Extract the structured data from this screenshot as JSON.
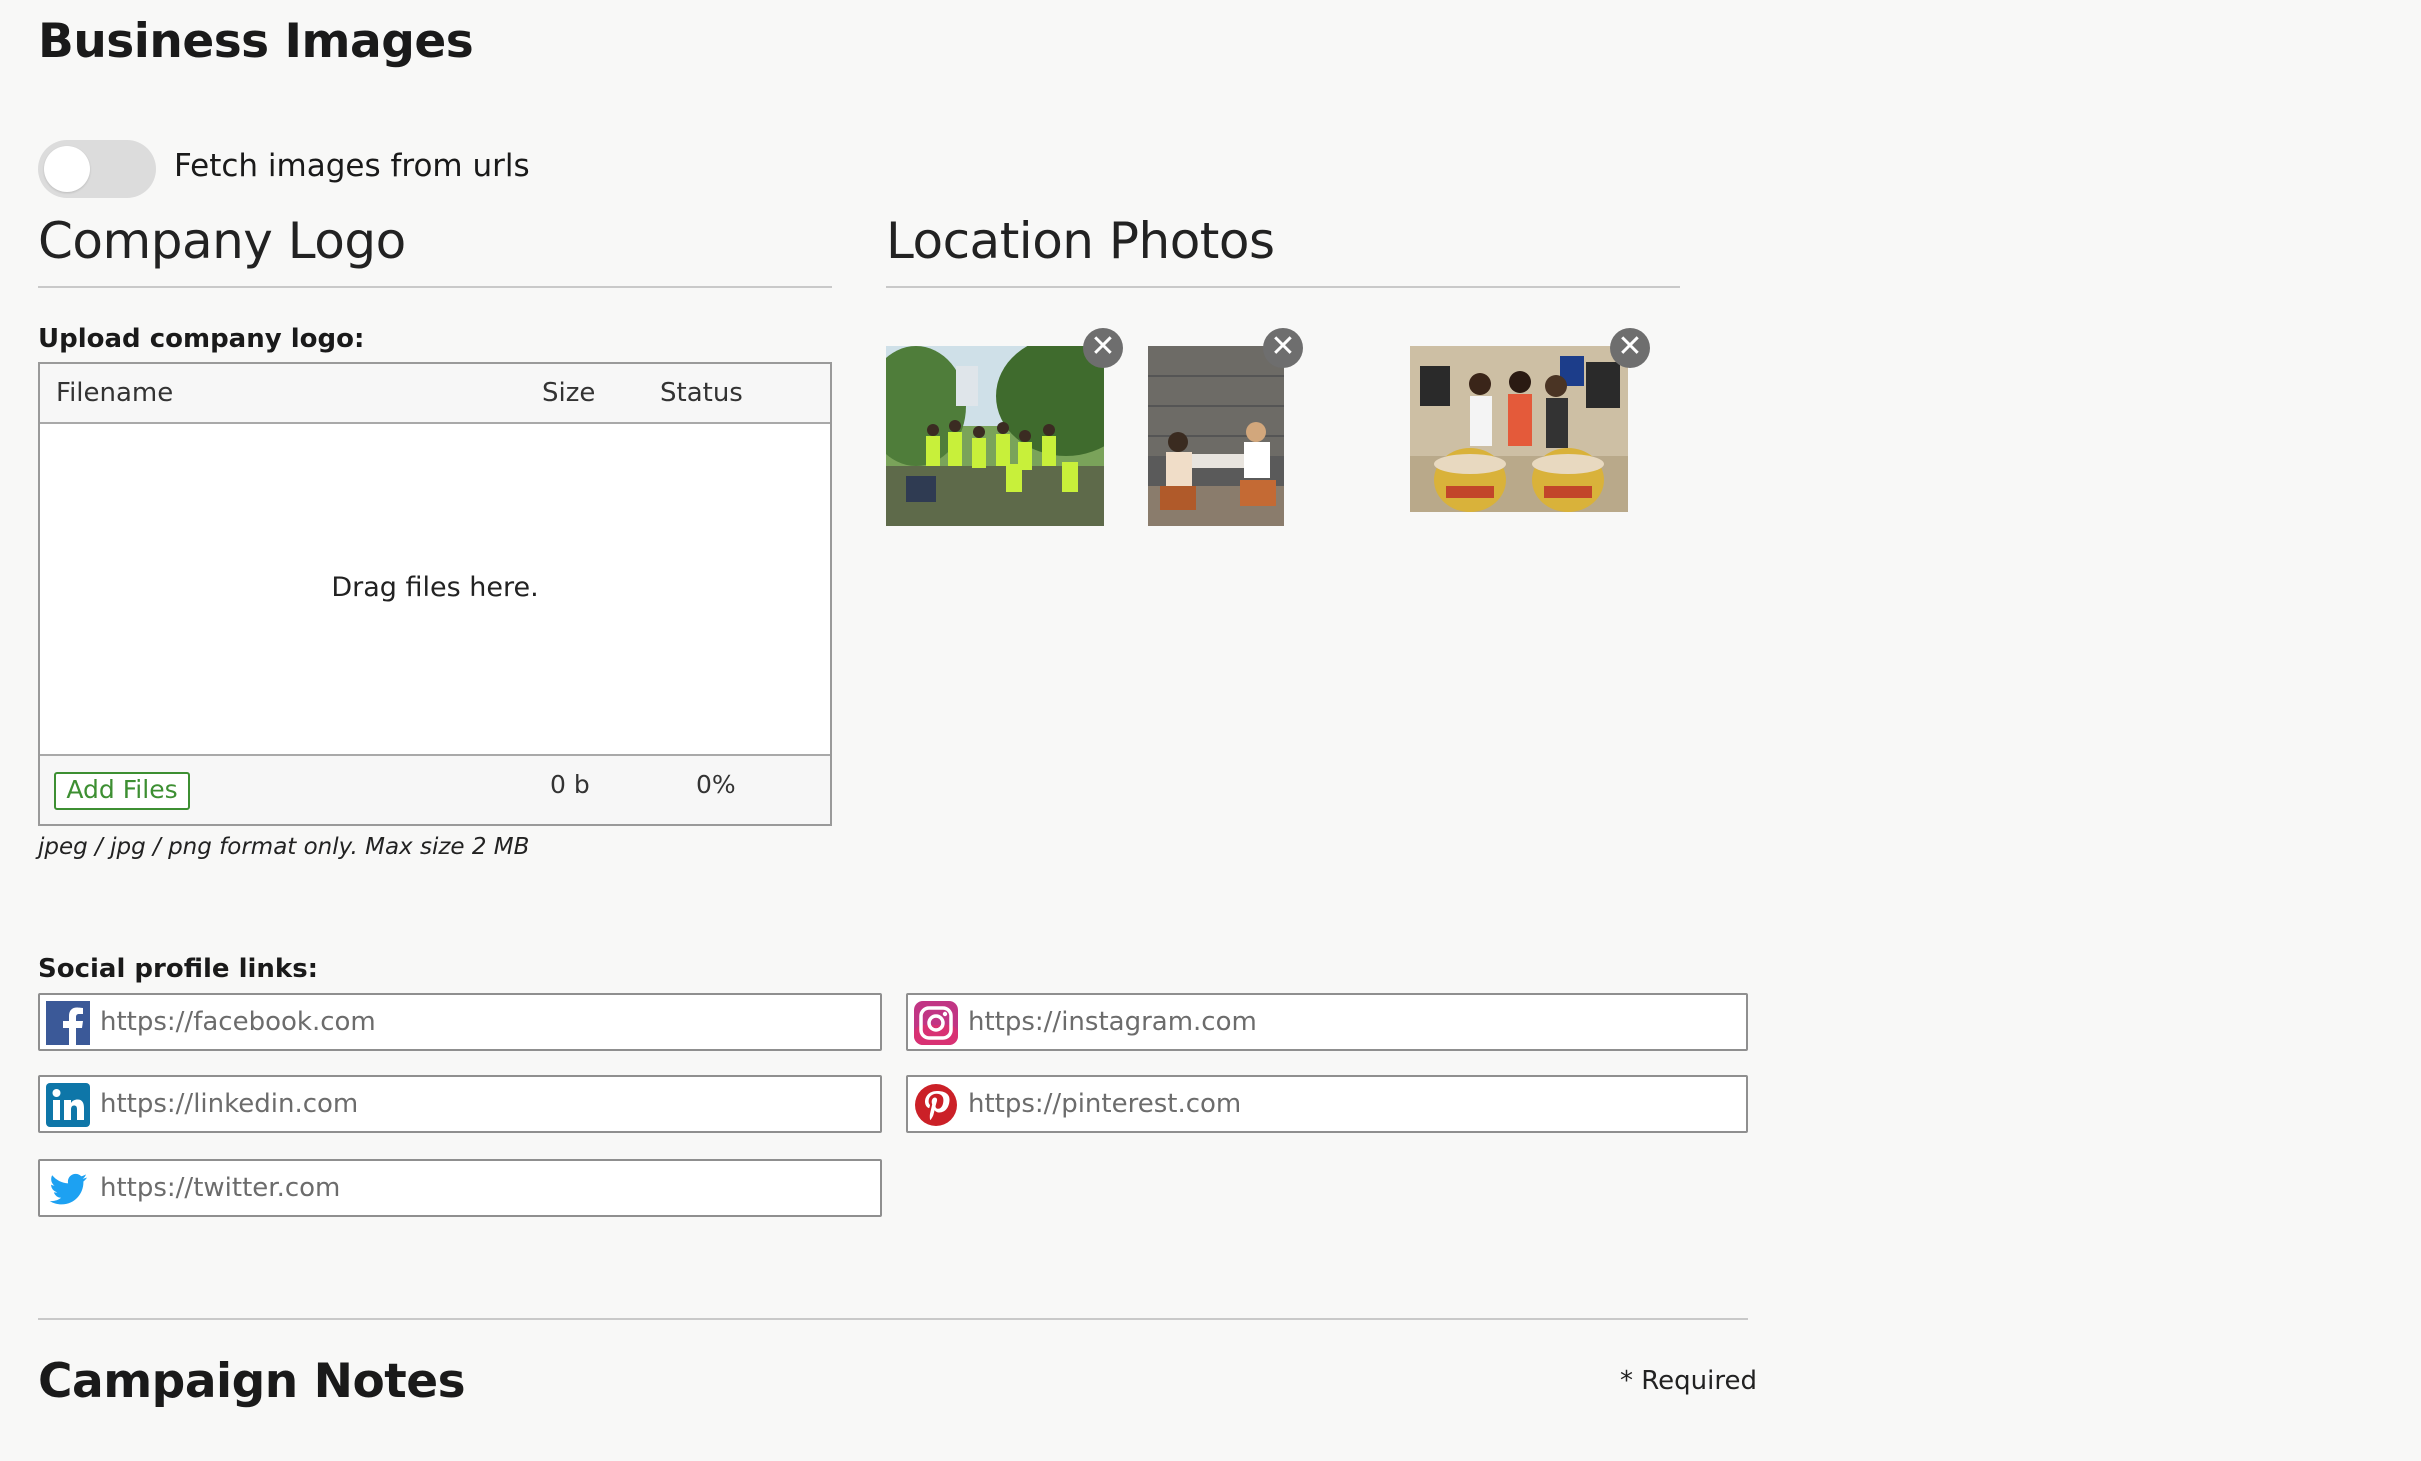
{
  "page": {
    "title": "Business Images"
  },
  "toggle": {
    "label": "Fetch images from urls",
    "on": false
  },
  "logo_section": {
    "title": "Company Logo",
    "upload_label": "Upload company logo:",
    "columns": {
      "filename": "Filename",
      "size": "Size",
      "status": "Status"
    },
    "drag_text": "Drag files here.",
    "add_files_label": "Add Files",
    "total_size": "0 b",
    "progress": "0%",
    "hint": "jpeg / jpg / png format only. Max size 2 MB"
  },
  "photos_section": {
    "title": "Location Photos",
    "remove_glyph": "✕",
    "photos": [
      {
        "name": "photo-group-outdoors"
      },
      {
        "name": "photo-office-meeting"
      },
      {
        "name": "photo-women-food-drive"
      }
    ]
  },
  "social": {
    "label": "Social profile links:",
    "facebook": {
      "placeholder": "https://facebook.com",
      "icon": "facebook-icon",
      "color": "#3b5998"
    },
    "instagram": {
      "placeholder": "https://instagram.com",
      "icon": "instagram-icon",
      "color": "#c13584"
    },
    "linkedin": {
      "placeholder": "https://linkedin.com",
      "icon": "linkedin-icon",
      "color": "#0e76a8"
    },
    "pinterest": {
      "placeholder": "https://pinterest.com",
      "icon": "pinterest-icon",
      "color": "#cb2027"
    },
    "twitter": {
      "placeholder": "https://twitter.com",
      "icon": "twitter-icon",
      "color": "#1da1f2"
    }
  },
  "notes": {
    "title": "Campaign Notes",
    "required": "* Required"
  },
  "colors": {
    "background": "#f8f8f7",
    "accent_green": "#3d8f32",
    "toggle_off": "#dcdcdc"
  }
}
